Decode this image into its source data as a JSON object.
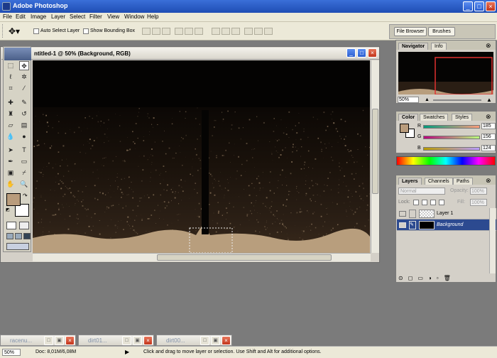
{
  "app": {
    "title": "Adobe Photoshop"
  },
  "menu": [
    "File",
    "Edit",
    "Image",
    "Layer",
    "Select",
    "Filter",
    "View",
    "Window",
    "Help"
  ],
  "options": {
    "auto_select_label": "Auto Select Layer",
    "show_bounding_label": "Show Bounding Box",
    "palette_well_tabs": [
      "File Browser",
      "Brushes"
    ]
  },
  "document": {
    "title": "ntitled-1 @ 50% (Background, RGB)"
  },
  "navigator": {
    "tabs": [
      "Navigator",
      "Info"
    ],
    "zoom": "50%"
  },
  "color": {
    "tabs": [
      "Color",
      "Swatches",
      "Styles"
    ],
    "channels": [
      {
        "label": "R",
        "value": "185"
      },
      {
        "label": "G",
        "value": "156"
      },
      {
        "label": "B",
        "value": "124"
      }
    ],
    "foreground": "#b99c7c",
    "background": "#ffffff"
  },
  "layers": {
    "tabs": [
      "Layers",
      "Channels",
      "Paths"
    ],
    "blend_mode": "Normal",
    "opacity_label": "Opacity:",
    "opacity_value": "100%",
    "lock_label": "Lock:",
    "fill_label": "Fill:",
    "fill_value": "100%",
    "items": [
      {
        "name": "Layer 1"
      },
      {
        "name": "Background"
      }
    ]
  },
  "taskbar": {
    "windows": [
      "racenu...",
      "dirt01...",
      "dirt00..."
    ]
  },
  "status": {
    "zoom": "50%",
    "doc_size": "Doc: 8,01M/6,08M",
    "hint": "Click and drag to move layer or selection.  Use Shift and Alt for additional options."
  }
}
